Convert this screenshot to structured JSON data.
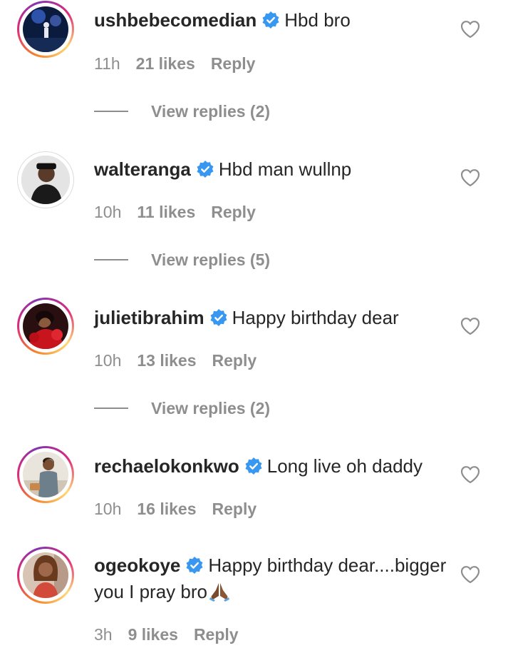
{
  "comments": [
    {
      "username": "ushbebecomedian",
      "text": "Hbd bro",
      "time": "11h",
      "likes": "21 likes",
      "reply": "Reply",
      "view_replies": "View replies (2)"
    },
    {
      "username": "walteranga",
      "text": "Hbd man wullnp",
      "time": "10h",
      "likes": "11 likes",
      "reply": "Reply",
      "view_replies": "View replies (5)"
    },
    {
      "username": "julietibrahim",
      "text": "Happy birthday dear",
      "time": "10h",
      "likes": "13 likes",
      "reply": "Reply",
      "view_replies": "View replies (2)"
    },
    {
      "username": "rechaelokonkwo",
      "text": "Long live oh daddy",
      "time": "10h",
      "likes": "16 likes",
      "reply": "Reply"
    },
    {
      "username": "ogeokoye",
      "text": "Happy birthday dear....bigger you I pray bro",
      "emoji": "folded-hands-emoji",
      "time": "3h",
      "likes": "9 likes",
      "reply": "Reply"
    }
  ],
  "icons": {
    "verified": "verified-badge-icon",
    "like": "heart-outline-icon"
  },
  "colors": {
    "text": "#262626",
    "meta": "#8e8e8e",
    "verified": "#3897f0",
    "story_ring_start": "#f58529",
    "story_ring_end": "#dd2a7b"
  }
}
